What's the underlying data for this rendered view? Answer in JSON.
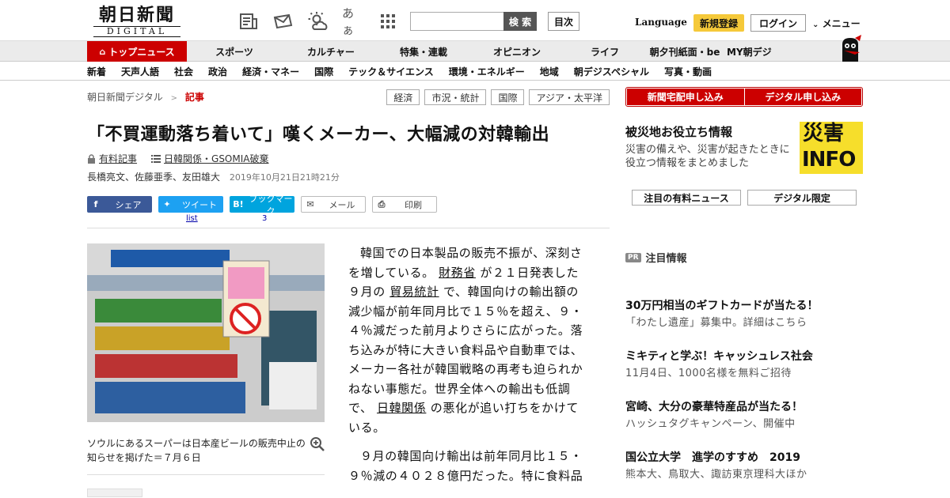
{
  "header": {
    "logo_jp": "朝日新聞",
    "logo_en": "DIGITAL",
    "search_placeholder": "",
    "search_button": "検 索",
    "toc_button": "目次",
    "language": "Language",
    "signup": "新規登録",
    "login": "ログイン",
    "menu": "メニュー",
    "icons": [
      "paper-icon",
      "newsletter-icon",
      "weather-icon",
      "font-size-icon",
      "grid-apps-icon"
    ],
    "font_size_label": "あぁ"
  },
  "nav": {
    "items": [
      "トップニュース",
      "スポーツ",
      "カルチャー",
      "特集・連載",
      "オピニオン",
      "ライフ",
      "朝夕刊紙面・be",
      "MY朝デジ"
    ]
  },
  "subnav": {
    "items": [
      "新着",
      "天声人語",
      "社会",
      "政治",
      "経済・マネー",
      "国際",
      "テック＆サイエンス",
      "環境・エネルギー",
      "地域",
      "朝デジスペシャル",
      "写真・動画"
    ]
  },
  "breadcrumb": {
    "root": "朝日新聞デジタル",
    "separator": ">",
    "current": "記事"
  },
  "tags": [
    "経済",
    "市況・統計",
    "国際",
    "アジア・太平洋"
  ],
  "article": {
    "title": "「不買運動落ち着いて」嘆くメーカー、大幅減の対韓輸出",
    "paid_label": "有料記事",
    "topic_label": "日韓関係・GSOMIA破棄",
    "authors": "長橋亮文、佐藤亜季、友田雄大",
    "date": "2019年10月21日21時21分",
    "share": {
      "facebook": "シェア",
      "twitter": "ツイート",
      "hatena": "ブックマーク",
      "mail": "メール",
      "print": "印刷",
      "tweet_count": "list",
      "bookmark_count": "3"
    },
    "photo_caption": "ソウルにあるスーパーは日本産ビールの販売中止の知らせを掲げた＝７月６日",
    "p1_a": "韓国での日本製品の販売不振が、深刻さを増している。",
    "p1_link1": "財務省",
    "p1_b": "が２１日発表した９月の",
    "p1_link2": "貿易統計",
    "p1_c": "で、韓国向けの輸出額の減少幅が前年同月比で１５％を超え、９・４％減だった前月よりさらに広がった。落ち込みが特に大きい食料品や自動車では、メーカー各社が韓国戦略の再考も迫られかねない事態だ。世界全体への輸出も低調で、",
    "p1_link3": "日韓関係",
    "p1_d": "の悪化が追い打ちをかけている。",
    "p2": "９月の韓国向け輸出は前年同月比１５・９％減の４０２８億円だった。特に食料品"
  },
  "sidebar": {
    "cta_left": "新聞宅配申し込み",
    "cta_right": "デジタル申し込み",
    "saigai_title": "被災地お役立ち情報",
    "saigai_desc": "災害の備えや、災害が起きたときに役立つ情報をまとめました",
    "saigai_logo_top": "災害",
    "saigai_logo_bottom": "INFO",
    "btn_paid_news": "注目の有料ニュース",
    "btn_digital": "デジタル限定",
    "pr_badge": "PR",
    "pr_heading": "注目情報",
    "pr_items": [
      {
        "title": "30万円相当のギフトカードが当たる！",
        "sub": "「わたし遺産」募集中。詳細はこちら"
      },
      {
        "title": "ミキティと学ぶ！キャッシュレス社会",
        "sub": "11月4日、1000名様を無料ご招待"
      },
      {
        "title": "宮崎、大分の豪華特産品が当たる！",
        "sub": "ハッシュタグキャンペーン、開催中"
      },
      {
        "title": "国公立大学　進学のすすめ　2019",
        "sub": "熊本大、鳥取大、諏訪東京理科大ほか"
      }
    ]
  },
  "colors": {
    "brand_red": "#cc0000",
    "signup_yellow": "#f5c93a",
    "facebook": "#3b5998",
    "twitter": "#1da1f2",
    "hatena": "#00a4de",
    "saigai_yellow": "#f6de2b"
  }
}
